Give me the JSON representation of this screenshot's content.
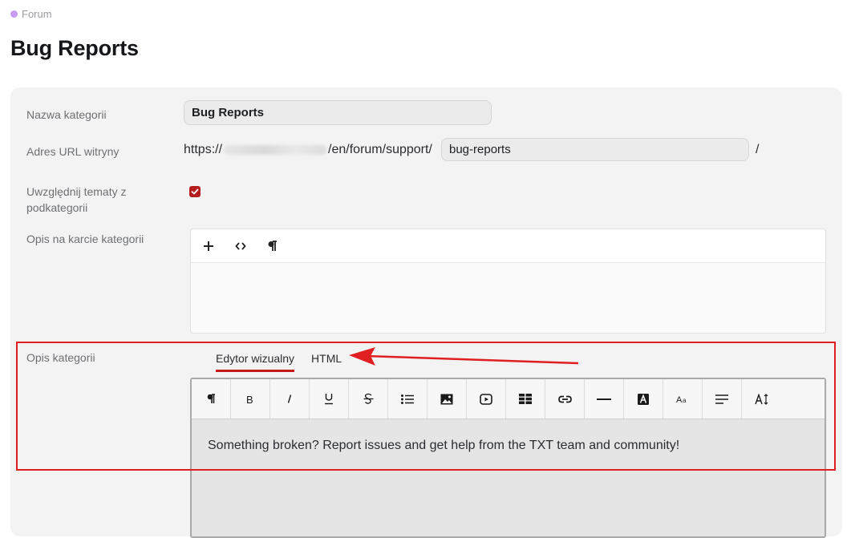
{
  "breadcrumb": {
    "label": "Forum"
  },
  "page": {
    "title": "Bug Reports"
  },
  "form": {
    "name_label": "Nazwa kategorii",
    "name_value": "Bug Reports",
    "url_label": "Adres URL witryny",
    "url_prefix_start": "https://",
    "url_prefix_end": "/en/forum/support/",
    "slug_value": "bug-reports",
    "url_suffix": "/",
    "include_label": "Uwzględnij tematy z podkategorii",
    "include_checked": true,
    "card_desc_label": "Opis na karcie kategorii",
    "desc_label": "Opis kategorii"
  },
  "card_editor": {
    "buttons": [
      "plus-icon",
      "code-icon",
      "paragraph-icon"
    ]
  },
  "desc_editor": {
    "tabs": [
      {
        "label": "Edytor wizualny",
        "active": true
      },
      {
        "label": "HTML",
        "active": false
      }
    ],
    "toolbar": [
      "paragraph-icon",
      "bold-icon",
      "italic-icon",
      "underline-icon",
      "strikethrough-icon",
      "list-icon",
      "image-icon",
      "video-icon",
      "table-icon",
      "link-icon",
      "horizontal-rule-icon",
      "text-color-icon",
      "font-size-icon",
      "align-icon",
      "line-height-icon"
    ],
    "content": "Something broken? Report issues and get help from the TXT team and community!"
  },
  "annotation": {
    "color": "#e02020"
  }
}
